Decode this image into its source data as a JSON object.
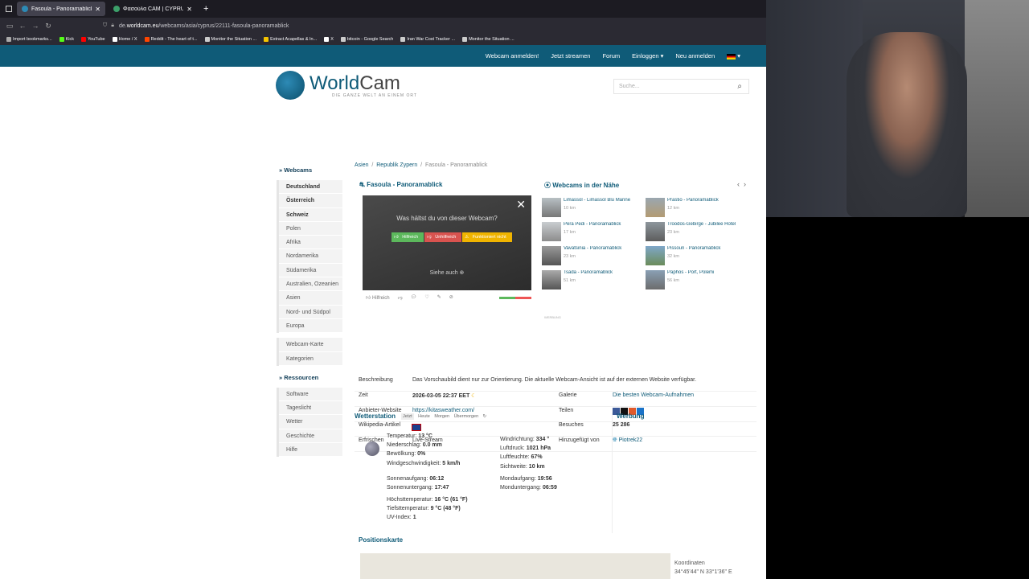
{
  "browser": {
    "tabs": [
      {
        "title": "Fasoula - Panoramablick, Repu",
        "active": true
      },
      {
        "title": "Φασούλα CAM | CYPRUS WEAT",
        "active": false
      }
    ],
    "url_prefix": "de.",
    "url_domain": "worldcam.eu",
    "url_path": "/webcams/asia/cyprus/22111-fasoula-panoramablick",
    "bookmarks": [
      "Import bookmarks...",
      "Kick",
      "YouTube",
      "Home / X",
      "Reddit - The heart of t...",
      "Monitor the Situation ...",
      "Extract Acapellas & In...",
      "X",
      "bitcoin - Google Search",
      "Iran War Cost Tracker ...",
      "Monitor the Situation ..."
    ]
  },
  "site": {
    "topnav": [
      "Webcam anmelden!",
      "Jetzt streamen",
      "Forum",
      "Einloggen ▾",
      "Neu anmelden"
    ],
    "logo_world": "World",
    "logo_cam": "Cam",
    "logo_tagline": "DIE GANZE WELT AN EINEM ORT",
    "search_placeholder": "Suche...",
    "sidebar": {
      "webcams_heading": "Webcams",
      "regions": [
        "Deutschland",
        "Österreich",
        "Schweiz",
        "Polen",
        "Afrika",
        "Nordamerika",
        "Südamerika",
        "Australien, Ozeanien",
        "Asien",
        "Nord- und Südpol",
        "Europa"
      ],
      "maps": [
        "Webcam-Karte",
        "Kategorien"
      ],
      "resources_heading": "Ressourcen",
      "resources": [
        "Software",
        "Tageslicht",
        "Wetter",
        "Geschichte",
        "Hilfe"
      ]
    },
    "breadcrumb": [
      "Asien",
      "Republik Zypern",
      "Fasoula - Panoramablick"
    ],
    "cam_title": "Fasoula - Panoramablick",
    "poll_question": "Was hältst du von dieser Webcam?",
    "poll_buttons": [
      "Hilfreich",
      "Unhilfreich",
      "Funktioniert nicht"
    ],
    "see_also": "Siehe auch ⊕",
    "helpful_label": "Hilfreich",
    "ad_label": "WERBUNG",
    "nearby_title": "Webcams in der Nähe",
    "nearby": [
      {
        "name": "Limassol - Limassol Blu Marine",
        "dist": "10 km"
      },
      {
        "name": "Prastio - Panoramablick",
        "dist": "12 km"
      },
      {
        "name": "Pera Pedi - Panoramablick",
        "dist": "17 km"
      },
      {
        "name": "Troodos-Gebirge - Jubilee Hotel",
        "dist": "23 km"
      },
      {
        "name": "Vavatsinia - Panoramablick",
        "dist": "23 km"
      },
      {
        "name": "Pissouri - Panoramablick",
        "dist": "32 km"
      },
      {
        "name": "Tsada - Panoramablick",
        "dist": "51 km"
      },
      {
        "name": "Paphos - Port, Polemi",
        "dist": "56 km"
      }
    ],
    "info": {
      "desc_label": "Beschreibung",
      "desc": "Das Vorschaubild dient nur zur Orientierung. Die aktuelle Webcam-Ansicht ist auf der externen Website verfügbar.",
      "time_label": "Zeit",
      "time": "2026-03-05 22:37 EET",
      "provider_label": "Anbieter-Website",
      "provider": "https://kitasweather.com/",
      "wiki_label": "Wikipedia-Artikel",
      "refresh_label": "Erfrischen",
      "refresh": "Live-Stream",
      "gallery_label": "Galerie",
      "gallery": "Die besten Webcam-Aufnahmen",
      "share_label": "Teilen",
      "visits_label": "Besuches",
      "visits": "25 286",
      "added_label": "Hinzugefügt von",
      "added": "Piotrek22"
    },
    "weather": {
      "title": "Wetterstation",
      "tabs": [
        "Jetzt",
        "Heute",
        "Morgen",
        "Übermorgen"
      ],
      "left": [
        {
          "l": "Temperatur: ",
          "v": "13 °C"
        },
        {
          "l": "Niederschlag: ",
          "v": "0.0 mm"
        },
        {
          "l": "Bewölkung: ",
          "v": "0%"
        },
        {
          "l": "Windgeschwindigkeit: ",
          "v": "5 km/h"
        }
      ],
      "right": [
        {
          "l": "Windrichtung: ",
          "v": "334 °"
        },
        {
          "l": "Luftdruck: ",
          "v": "1021 hPa"
        },
        {
          "l": "Luftfeuchte: ",
          "v": "67%"
        },
        {
          "l": "Sichtweite: ",
          "v": "10 km"
        }
      ],
      "sun": [
        {
          "l": "Sonnenaufgang: ",
          "v": "06:12"
        },
        {
          "l": "Sonnenuntergang: ",
          "v": "17:47"
        }
      ],
      "moon": [
        {
          "l": "Mondaufgang: ",
          "v": "19:56"
        },
        {
          "l": "Monduntergang: ",
          "v": "06:59"
        }
      ],
      "extra": [
        {
          "l": "Höchsttemperatur: ",
          "v": "16 °C (61 °F)"
        },
        {
          "l": "Tiefsttemperatur: ",
          "v": "9 °C (48 °F)"
        },
        {
          "l": "UV-Index: ",
          "v": "1"
        }
      ]
    },
    "werbung": "Werbung",
    "positions_title": "Positionskarte",
    "coord_label": "Koordinaten",
    "coord_value": "34°45'44\" N 33°1'36\" E"
  }
}
